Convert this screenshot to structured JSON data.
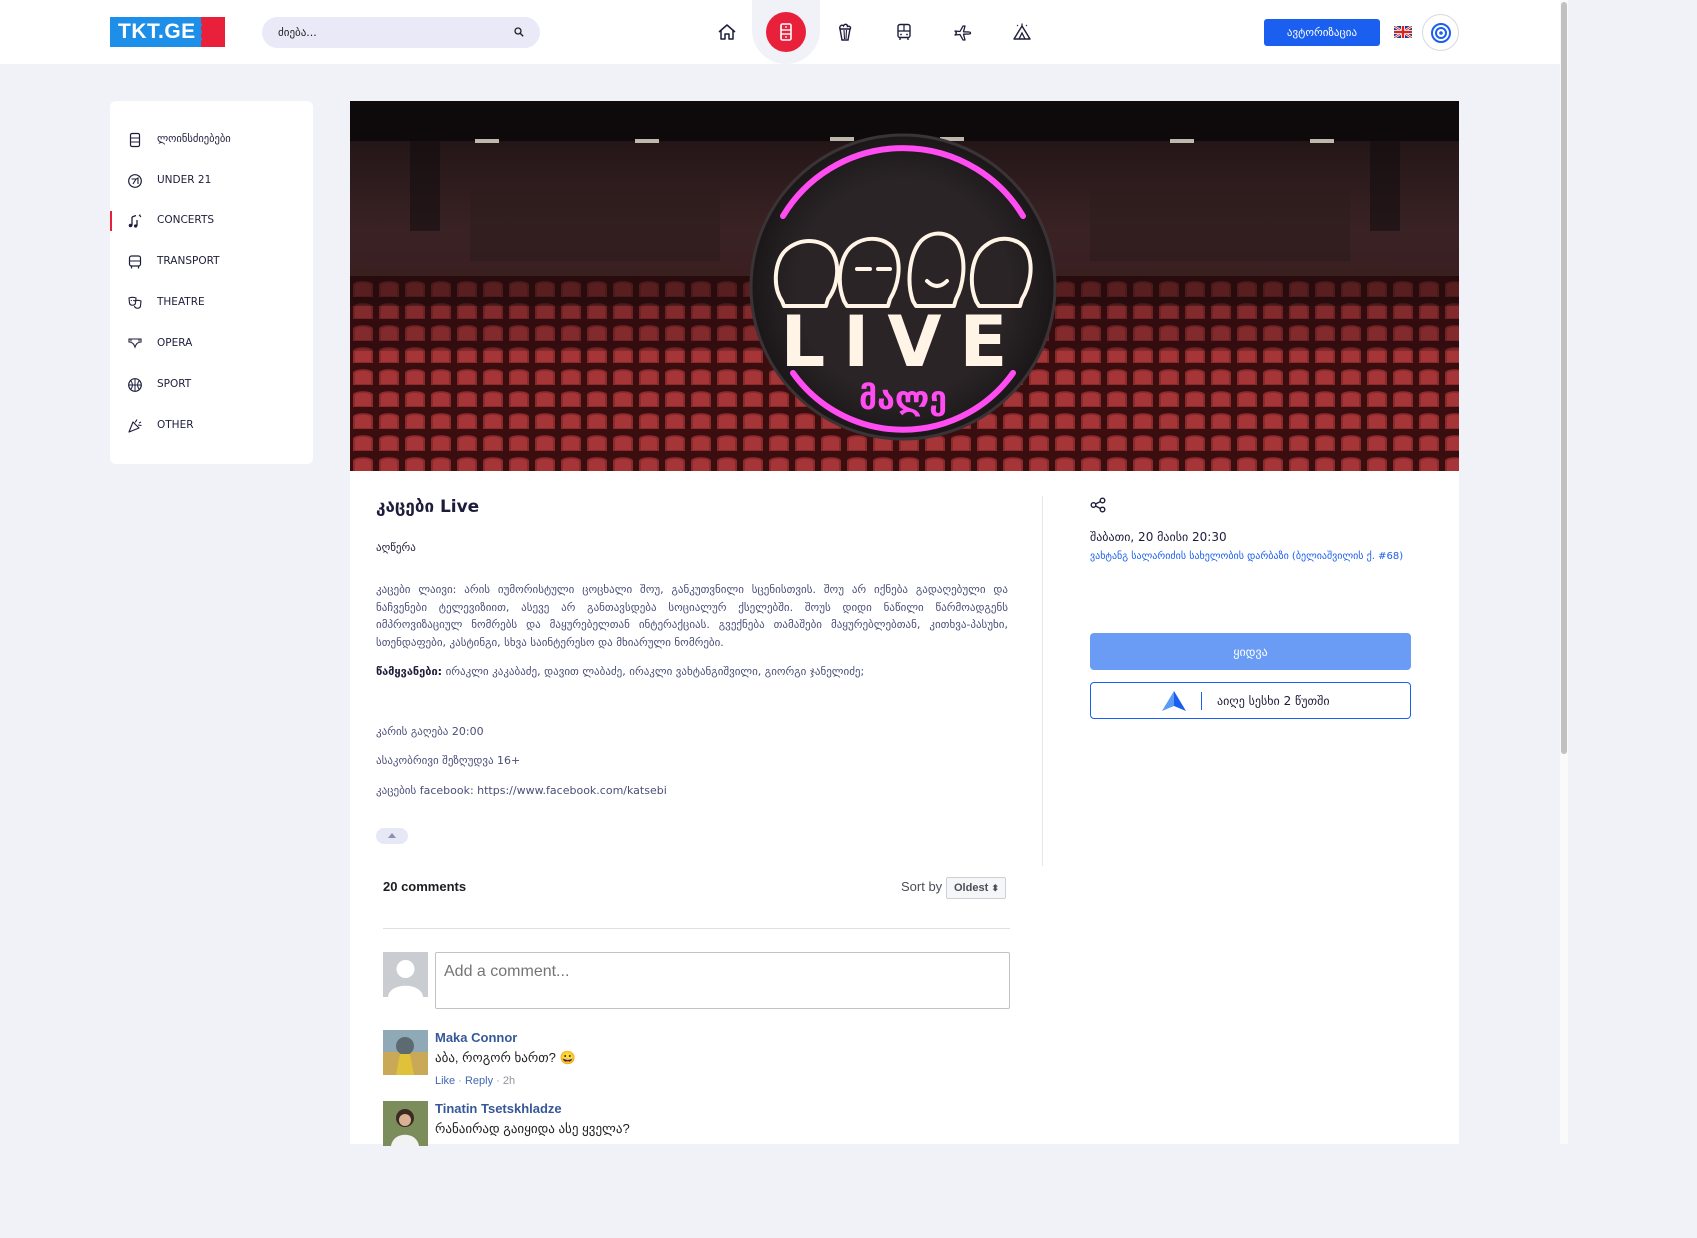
{
  "header": {
    "logo_text": "TKT.GE",
    "search_placeholder": "ძიება...",
    "nav_icons": [
      "home-icon",
      "ticket-icon",
      "popcorn-icon",
      "bus-icon",
      "plane-icon",
      "tent-icon"
    ],
    "auth_label": "ავტორიზაცია",
    "language": "english-flag-icon"
  },
  "sidebar": {
    "items": [
      {
        "label": "ლოინსძიებები",
        "icon": "ticket-icon"
      },
      {
        "label": "UNDER 21",
        "icon": "under21-icon"
      },
      {
        "label": "CONCERTS",
        "icon": "music-icon",
        "active": true
      },
      {
        "label": "TRANSPORT",
        "icon": "bus-icon"
      },
      {
        "label": "THEATRE",
        "icon": "masks-icon"
      },
      {
        "label": "OPERA",
        "icon": "opera-icon"
      },
      {
        "label": "SPORT",
        "icon": "ball-icon"
      },
      {
        "label": "OTHER",
        "icon": "party-icon"
      }
    ]
  },
  "event": {
    "banner_text": "LIVE",
    "banner_subtext": "მალე",
    "title": "კაცები Live",
    "subhead": "აღწერა",
    "description": "კაცები ლაივი: არის იუმორისტული ცოცხალი შოუ, განკუთვნილი სცენისთვის. შოუ არ იქნება გადაღებული და ნაჩვენები ტელევიზიით, ასევე არ განთავსდება სოციალურ ქსელებში. შოუს დიდი ნაწილი წარმოადგენს იმპროვიზაციულ ნომრებს და მაყურებელთან ინტერაქციას. გვექნება თამაშები მაყურებლებთან, კითხვა-პასუხი, სთენდაფები, კასტინგი, სხვა საინტერესო და მხიარული ნომრები.",
    "hosts_label": "წამყვანები:",
    "hosts": "ირაკლი კაკაბაძე, დავით ლაბაძე, ირაკლი ვახტანგიშვილი, გიორგი ჯანელიძე;",
    "doors": "კარის გაღება 20:00",
    "age": "ასაკობრივი შეზღუდვა 16+",
    "facebook": "კაცების facebook: https://www.facebook.com/katsebi",
    "date": "შაბათი, 20 მაისი 20:30",
    "venue": "ვახტანგ სალარიძის სახელობის დარბაზი (ბელიაშვილის ქ. #68)",
    "buy_label": "ყიდვა",
    "alt_label": "აიღე სესხი 2 წუთში"
  },
  "comments": {
    "count_label": "20 comments",
    "sort_label": "Sort by",
    "sort_value": "Oldest",
    "input_placeholder": "Add a comment...",
    "items": [
      {
        "name": "Maka Connor",
        "text": "აბა, როგორ ხართ? 😀",
        "like": "Like",
        "reply": "Reply",
        "time": "2h"
      },
      {
        "name": "Tinatin Tsetskhladze",
        "text": "რანაირად გაიყიდა ასე ყველა?"
      }
    ]
  },
  "colors": {
    "accent": "#e8203a",
    "primary": "#1a5ff0",
    "buy_button": "#6a9cf6",
    "page_bg": "#f1f1f8"
  }
}
